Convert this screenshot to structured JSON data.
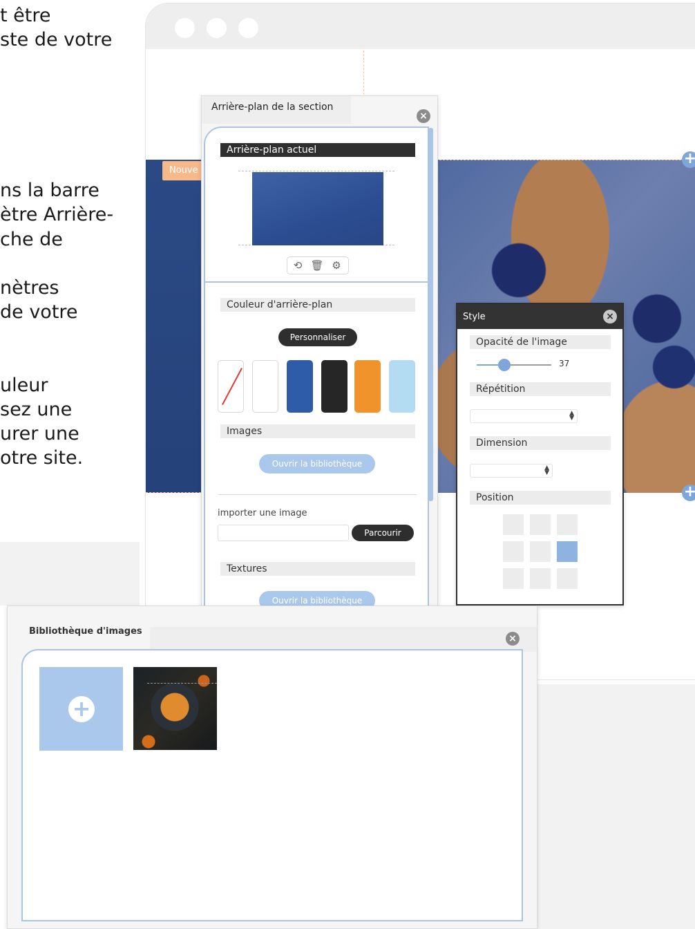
{
  "instructions": {
    "lines_top": [
      "t être",
      "ste de votre"
    ],
    "lines_mid": [
      "ns la barre",
      "ètre Arrière-",
      "che de"
    ],
    "lines_mid2": [
      "nètres",
      "de votre"
    ],
    "lines_bottom": [
      "uleur",
      "sez une",
      "urer une",
      "otre site."
    ]
  },
  "hero": {
    "badge": "Nouve"
  },
  "section_panel": {
    "title": "Arrière-plan de la section",
    "current_bg_label": "Arrière-plan actuel",
    "color_label": "Couleur d'arrière-plan",
    "customize_button": "Personnaliser",
    "swatches": [
      "none",
      "#ffffff",
      "#2f5ca8",
      "#262626",
      "#f0932b",
      "#b3dbf2"
    ],
    "images_label": "Images",
    "open_library_button": "Ouvrir la bibliothèque",
    "import_label": "importer une image",
    "browse_button": "Parcourir",
    "textures_label": "Textures",
    "open_library_button_2": "Ouvrir la bibliothèque"
  },
  "style_panel": {
    "title": "Style",
    "opacity_label": "Opacité de l'image",
    "opacity_value": "37",
    "opacity_fraction": 0.37,
    "repeat_label": "Répétition",
    "dimension_label": "Dimension",
    "position_label": "Position",
    "position_selected": "middle-right"
  },
  "library_panel": {
    "title": "Bibliothèque d'images"
  },
  "colors": {
    "accent_blue": "#a9c8ec",
    "dark": "#2f2f2f",
    "hero_blue": "#2b4a85"
  }
}
